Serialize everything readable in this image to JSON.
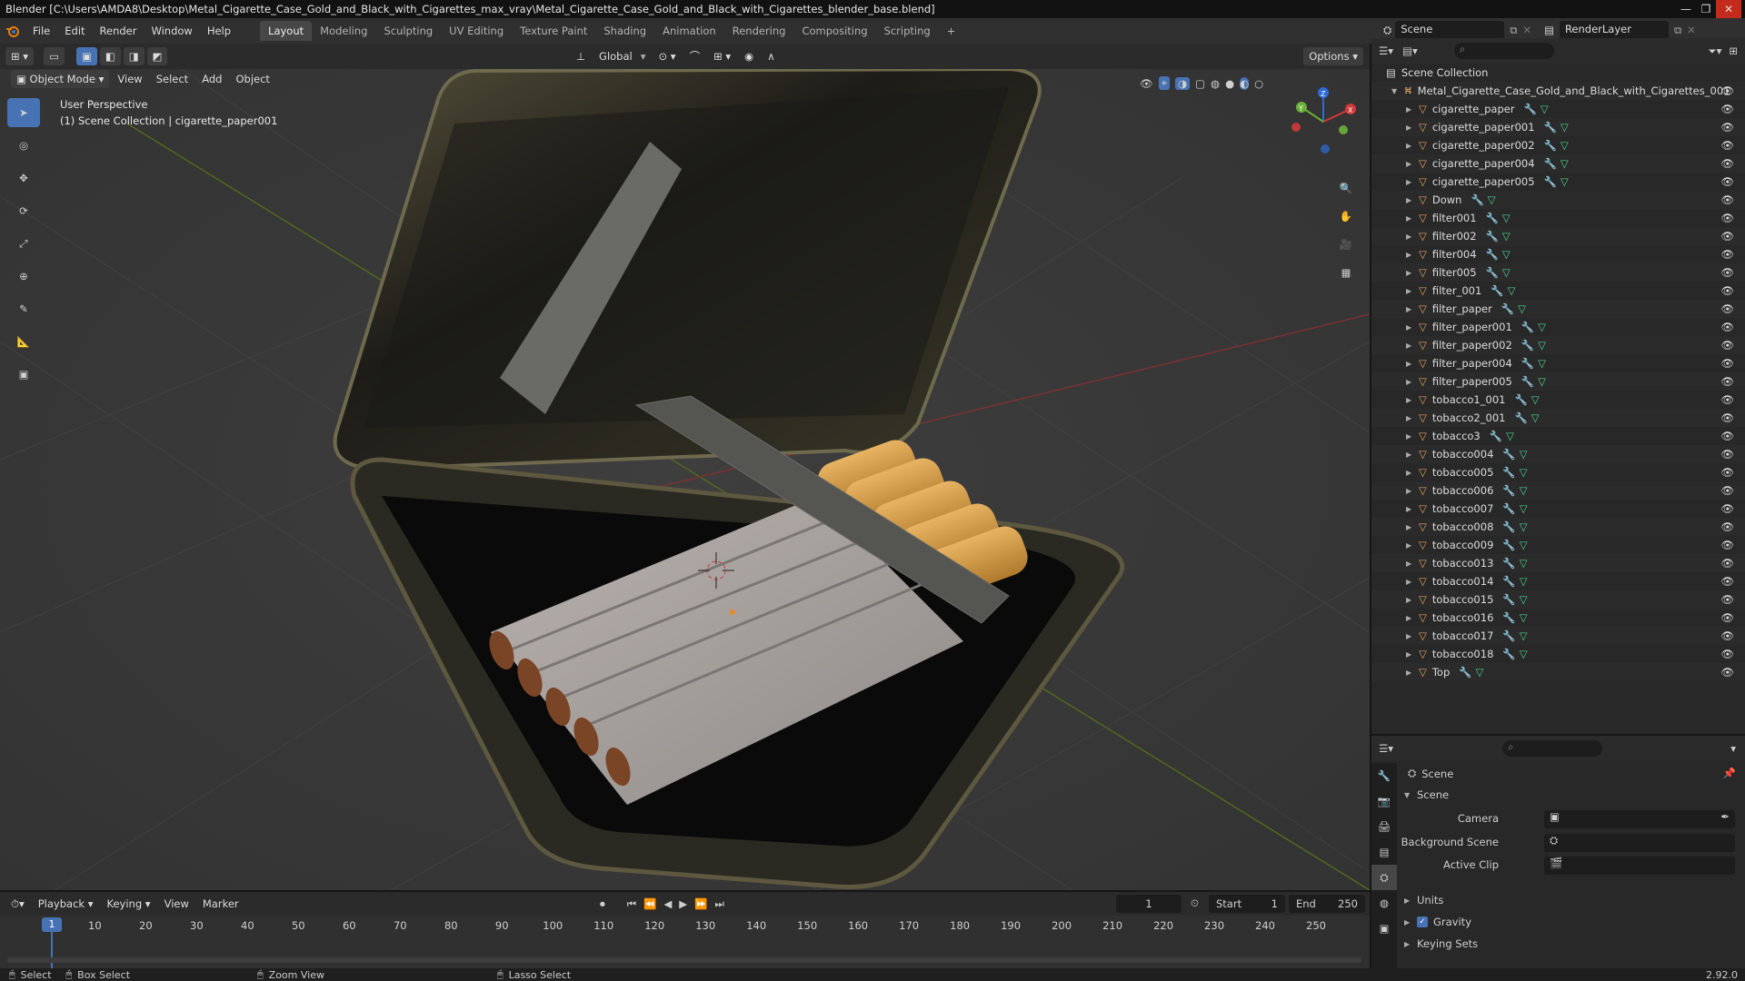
{
  "titlebar": {
    "title": "Blender [C:\\Users\\AMDA8\\Desktop\\Metal_Cigarette_Case_Gold_and_Black_with_Cigarettes_max_vray\\Metal_Cigarette_Case_Gold_and_Black_with_Cigarettes_blender_base.blend]"
  },
  "menu": [
    "File",
    "Edit",
    "Render",
    "Window",
    "Help"
  ],
  "workspaces": [
    "Layout",
    "Modeling",
    "Sculpting",
    "UV Editing",
    "Texture Paint",
    "Shading",
    "Animation",
    "Rendering",
    "Compositing",
    "Scripting"
  ],
  "scene_field": "Scene",
  "render_layer": "RenderLayer",
  "vp_header": {
    "orientation": "Global",
    "options": "Options"
  },
  "vp_header2": {
    "mode": "Object Mode",
    "view": "View",
    "select": "Select",
    "add": "Add",
    "object": "Object"
  },
  "viewport": {
    "perspective": "User Perspective",
    "collection": "(1) Scene Collection | cigarette_paper001"
  },
  "gizmo": {
    "x": "X",
    "y": "Y",
    "z": "Z"
  },
  "outliner": {
    "root": "Scene Collection",
    "collection": "Metal_Cigarette_Case_Gold_and_Black_with_Cigarettes_001",
    "items": [
      "cigarette_paper",
      "cigarette_paper001",
      "cigarette_paper002",
      "cigarette_paper004",
      "cigarette_paper005",
      "Down",
      "filter001",
      "filter002",
      "filter004",
      "filter005",
      "filter_001",
      "filter_paper",
      "filter_paper001",
      "filter_paper002",
      "filter_paper004",
      "filter_paper005",
      "tobacco1_001",
      "tobacco2_001",
      "tobacco3",
      "tobacco004",
      "tobacco005",
      "tobacco006",
      "tobacco007",
      "tobacco008",
      "tobacco009",
      "tobacco013",
      "tobacco014",
      "tobacco015",
      "tobacco016",
      "tobacco017",
      "tobacco018",
      "Top"
    ]
  },
  "props": {
    "context": "Scene",
    "panel": "Scene",
    "camera": "Camera",
    "bg_scene": "Background Scene",
    "active_clip": "Active Clip",
    "sections": [
      "Units",
      "Gravity",
      "Keying Sets"
    ]
  },
  "timeline": {
    "playback": "Playback",
    "keying": "Keying",
    "view": "View",
    "marker": "Marker",
    "current": "1",
    "start_label": "Start",
    "start": "1",
    "end_label": "End",
    "end": "250",
    "ticks": [
      "1",
      "10",
      "20",
      "30",
      "40",
      "50",
      "60",
      "70",
      "80",
      "90",
      "100",
      "110",
      "120",
      "130",
      "140",
      "150",
      "160",
      "170",
      "180",
      "190",
      "200",
      "210",
      "220",
      "230",
      "240",
      "250"
    ]
  },
  "status": {
    "select": "Select",
    "box": "Box Select",
    "zoom": "Zoom View",
    "lasso": "Lasso Select",
    "version": "2.92.0"
  }
}
